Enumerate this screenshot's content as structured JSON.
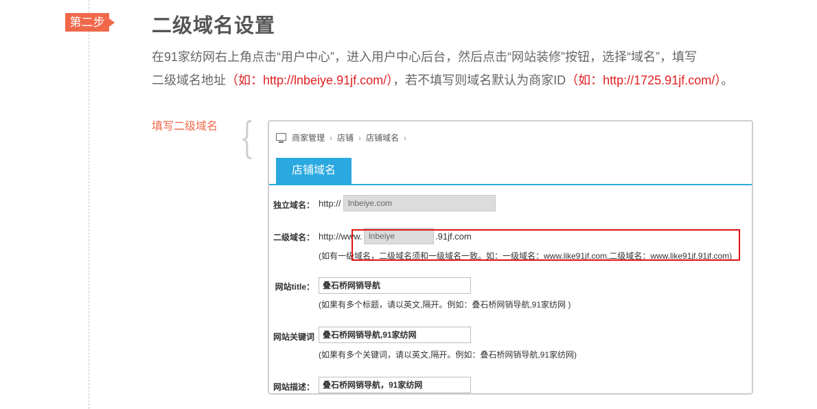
{
  "step_badge": "第二步",
  "title": "二级域名设置",
  "para": {
    "line1": "在91家纺网右上角点击“用户中心”，进入用户中心后台，然后点击“网站装修”按钮，选择“域名”，填写",
    "line2_a": "二级域名地址",
    "line2_red1": "（如：http://lnbeiye.91jf.com/）",
    "line2_b": "，若不填写则域名默认为商家ID",
    "line2_red2": "（如：http://1725.91jf.com/）",
    "line2_c": "。"
  },
  "side_label": "填写二级域名",
  "screenshot": {
    "breadcrumb": [
      "商家管理",
      "店铺",
      "店铺域名"
    ],
    "breadcrumb_sep": "›",
    "tab": "店铺域名",
    "fields": {
      "standalone": {
        "label": "独立域名：",
        "prefix": "http://",
        "value": "lnbeiye.com"
      },
      "subdomain": {
        "label": "二级域名：",
        "prefix": "http://www.",
        "value": "lnbeiye",
        "suffix": ".91jf.com",
        "hint": "(如有一级域名，二级域名须和一级域名一致。如：一级域名：www.like91jf.com,二级域名：www.like91jf.91jf.com)"
      },
      "site_title": {
        "label": "网站title：",
        "value": "叠石桥网销导航",
        "hint": "(如果有多个标题，请以英文,隔开。例如：叠石桥网销导航,91家纺网 )"
      },
      "keywords": {
        "label": "网站关键词：",
        "value": "叠石桥网销导航,91家纺网",
        "hint": "(如果有多个关键词，请以英文,隔开。例如：叠石桥网销导航,91家纺网)"
      },
      "description": {
        "label": "网站描述：",
        "value": "叠石桥网销导航，91家纺网"
      }
    }
  },
  "colors": {
    "accent": "#f0684a",
    "highlight_red": "#e02020",
    "tab_blue": "#2aa9e0"
  }
}
